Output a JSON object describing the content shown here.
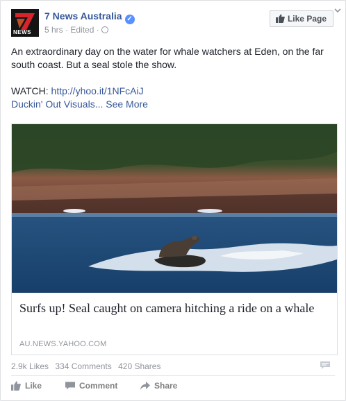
{
  "post": {
    "page_name": "7 News Australia",
    "logo_text": "NEWS",
    "time": "5 hrs",
    "edited": "Edited",
    "sep": "·",
    "like_page_label": "Like Page",
    "text_line1": "An extraordinary day on the water for whale watchers at Eden, on the far south coast. But a seal stole the show.",
    "watch_label": "WATCH: ",
    "watch_link": "http://yhoo.it/1NFcAiJ",
    "credit_text": "Duckin' Out Visuals...",
    "see_more": "See More"
  },
  "link_card": {
    "title": "Surfs up! Seal caught on camera hitching a ride on a whale",
    "domain": "AU.NEWS.YAHOO.COM"
  },
  "stats": {
    "likes": "2.9k Likes",
    "comments": "334 Comments",
    "shares": "420 Shares"
  },
  "actions": {
    "like": "Like",
    "comment": "Comment",
    "share": "Share"
  },
  "colors": {
    "link_blue": "#365899",
    "muted": "#90949c",
    "logo_red": "#d8232a",
    "sea": "#1d4f82"
  }
}
